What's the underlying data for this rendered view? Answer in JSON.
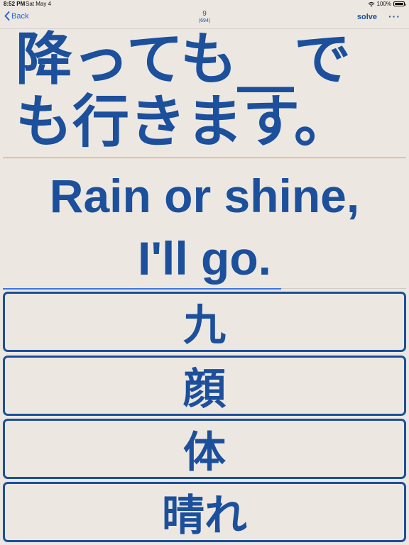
{
  "status_bar": {
    "time": "8:52 PM",
    "date": "Sat May 4",
    "battery": "100%",
    "battery_level": 1.0
  },
  "nav": {
    "back_label": "Back",
    "count": "9",
    "total": "(694)",
    "solve_label": "solve",
    "more_label": "···"
  },
  "question": {
    "text": "降っても__でも行きます。"
  },
  "translation": {
    "line1": "Rain or shine,",
    "line2": "I'll go."
  },
  "choices": [
    {
      "label": "九"
    },
    {
      "label": "顔"
    },
    {
      "label": "体"
    },
    {
      "label": "晴れ"
    }
  ],
  "colors": {
    "background": "#ece8e1",
    "primary": "#1c4f9c",
    "link": "#2a64d6",
    "divider_accent": "#e58b54",
    "progress": "#3b77e0"
  },
  "icons": {
    "back": "chevron-left-icon",
    "wifi": "wifi-icon",
    "battery": "battery-icon"
  }
}
